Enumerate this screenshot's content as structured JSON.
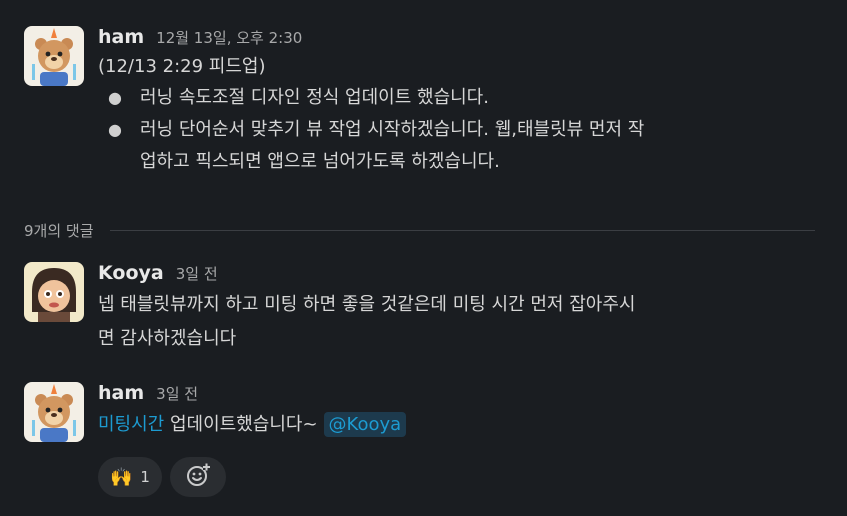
{
  "colors": {
    "background": "#1a1d21",
    "text": "#d1d2d3",
    "link": "#1d9bd1",
    "muted": "#a8a9aa"
  },
  "messages": [
    {
      "author": "ham",
      "timestamp": "12월 13일, 오후 2:30",
      "avatar_icon": "quokka-avatar",
      "title": "(12/13 2:29 피드업)",
      "bullet_symbol": "●",
      "bullets": [
        {
          "lines": [
            "러닝 속도조절 디자인 정식 업데이트 했습니다."
          ]
        },
        {
          "lines": [
            "러닝 단어순서 맞추기 뷰 작업 시작하겠습니다. 웹,태블릿뷰 먼저 작",
            "업하고 픽스되면 앱으로 넘어가도록 하겠습니다."
          ]
        }
      ]
    }
  ],
  "thread": {
    "reply_count_label": "9개의 댓글",
    "replies": [
      {
        "author": "Kooya",
        "timestamp": "3일 전",
        "avatar_icon": "cartoon-girl-avatar",
        "lines": [
          "넵 태블릿뷰까지 하고 미팅 하면 좋을 것같은데 미팅 시간 먼저 잡아주시",
          "면 감사하겠습니다"
        ]
      },
      {
        "author": "ham",
        "timestamp": "3일 전",
        "avatar_icon": "quokka-avatar",
        "link_text": "미팅시간",
        "text": " 업데이트했습니다~",
        "mention": "@Kooya",
        "reactions": [
          {
            "emoji": "🙌",
            "emoji_name": "raised-hands-icon",
            "count": "1"
          }
        ],
        "add_reaction_icon": "add-emoji-icon"
      }
    ]
  }
}
